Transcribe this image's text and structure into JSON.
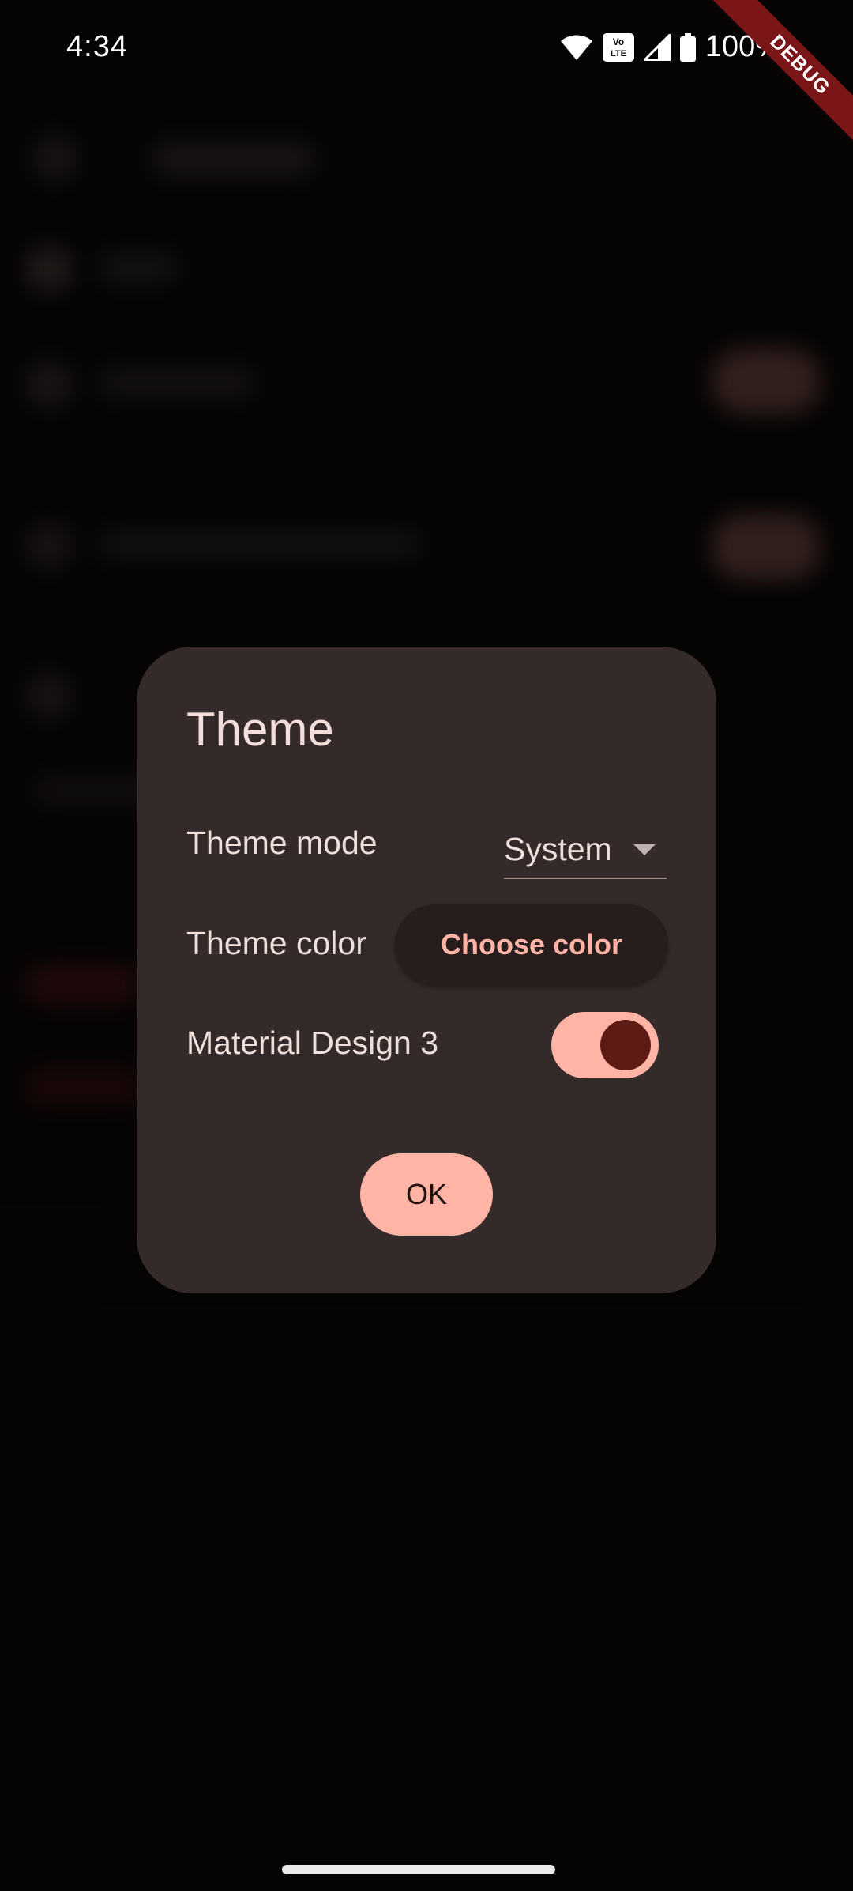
{
  "status_bar": {
    "time": "4:34",
    "battery": "100%",
    "icons": [
      "wifi-icon",
      "volte-icon",
      "signal-icon",
      "battery-icon"
    ]
  },
  "debug_ribbon": {
    "label": "DEBUG"
  },
  "dialog": {
    "title": "Theme",
    "theme_mode": {
      "label": "Theme mode",
      "selected": "System"
    },
    "theme_color": {
      "label": "Theme color",
      "button_label": "Choose color"
    },
    "material_design": {
      "label": "Material Design 3",
      "enabled": true
    },
    "ok_label": "OK"
  },
  "colors": {
    "accent": "#ffb4a6",
    "dialog_bg": "#342a29",
    "switch_thumb": "#5e1b14",
    "debug_ribbon": "#7a1518"
  }
}
